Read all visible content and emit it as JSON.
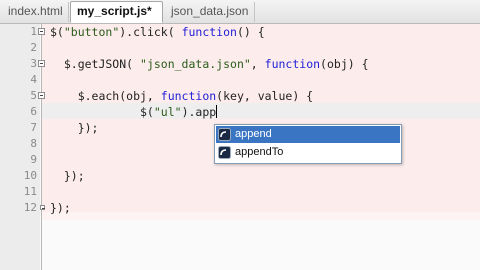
{
  "tabs": [
    {
      "label": "index.html",
      "active": false
    },
    {
      "label": "my_script.js*",
      "active": true
    },
    {
      "label": "json_data.json",
      "active": false
    }
  ],
  "editor": {
    "line_numbers": [
      "1",
      "2",
      "3",
      "4",
      "5",
      "6",
      "7",
      "8",
      "9",
      "10",
      "11",
      "12"
    ],
    "lines": [
      {
        "tokens": [
          {
            "t": "$(",
            "c": "punc"
          },
          {
            "t": "\"button\"",
            "c": "str"
          },
          {
            "t": ").click( ",
            "c": "punc"
          },
          {
            "t": "function",
            "c": "kw"
          },
          {
            "t": "() {",
            "c": "punc"
          }
        ]
      },
      {
        "tokens": []
      },
      {
        "tokens": [
          {
            "t": "  $.getJSON( ",
            "c": "punc"
          },
          {
            "t": "\"json_data.json\"",
            "c": "str"
          },
          {
            "t": ", ",
            "c": "punc"
          },
          {
            "t": "function",
            "c": "kw"
          },
          {
            "t": "(obj) {",
            "c": "punc"
          }
        ]
      },
      {
        "tokens": []
      },
      {
        "tokens": [
          {
            "t": "    $.each(obj, ",
            "c": "punc"
          },
          {
            "t": "function",
            "c": "kw"
          },
          {
            "t": "(key, value) {",
            "c": "punc"
          }
        ]
      },
      {
        "tokens": [
          {
            "t": "             $(",
            "c": "punc"
          },
          {
            "t": "\"ul\"",
            "c": "str"
          },
          {
            "t": ").app",
            "c": "punc"
          }
        ]
      },
      {
        "tokens": [
          {
            "t": "    });",
            "c": "punc"
          }
        ]
      },
      {
        "tokens": []
      },
      {
        "tokens": []
      },
      {
        "tokens": [
          {
            "t": "  });",
            "c": "punc"
          }
        ]
      },
      {
        "tokens": []
      },
      {
        "tokens": [
          {
            "t": "});",
            "c": "punc"
          }
        ]
      }
    ]
  },
  "autocomplete": {
    "items": [
      {
        "label": "append",
        "selected": true,
        "icon": "method-icon"
      },
      {
        "label": "appendTo",
        "selected": false,
        "icon": "method-icon"
      }
    ]
  },
  "colors": {
    "keyword": "#1e1ed6",
    "string": "#2a5c1a",
    "selection": "#3a75c4",
    "region_highlight": "#fdecec"
  }
}
